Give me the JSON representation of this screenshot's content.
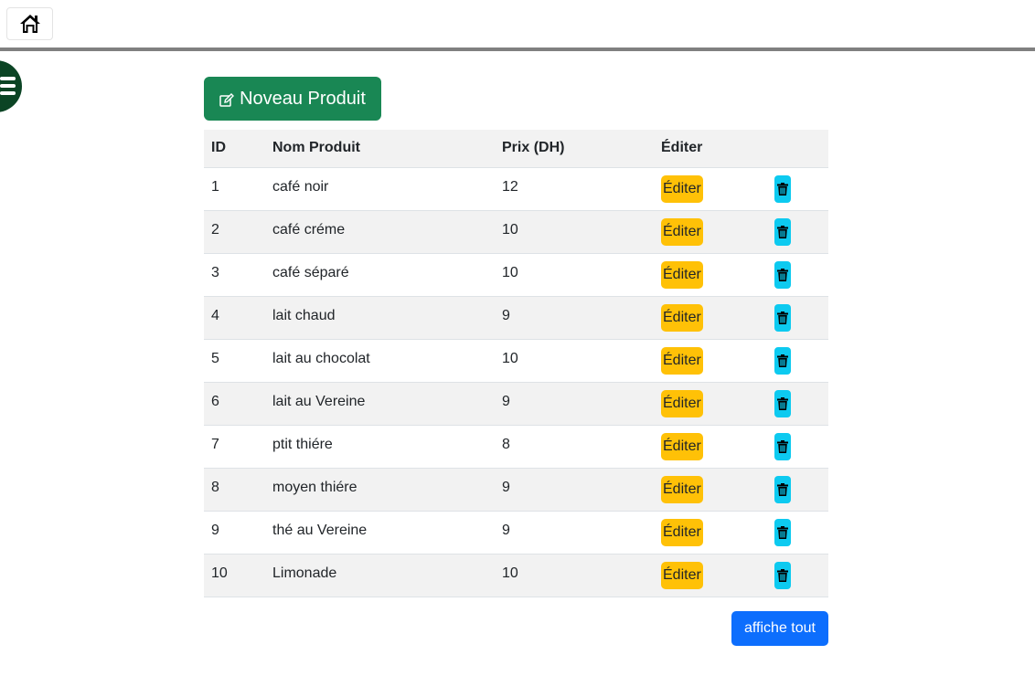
{
  "nav": {
    "home_icon": "home-icon",
    "menu_icon": "hamburger-icon"
  },
  "toolbar": {
    "new_product_label": "Noveau Produit",
    "new_product_icon": "edit-square-icon"
  },
  "table": {
    "headers": {
      "id": "ID",
      "name": "Nom Produit",
      "price": "Prix (DH)",
      "edit": "Éditer"
    },
    "edit_label": "Éditer",
    "delete_icon": "trash-icon",
    "rows": [
      {
        "id": "1",
        "name": "café noir",
        "price": "12"
      },
      {
        "id": "2",
        "name": "café créme",
        "price": "10"
      },
      {
        "id": "3",
        "name": "café séparé",
        "price": "10"
      },
      {
        "id": "4",
        "name": "lait chaud",
        "price": "9"
      },
      {
        "id": "5",
        "name": "lait au chocolat",
        "price": "10"
      },
      {
        "id": "6",
        "name": "lait au Vereine",
        "price": "9"
      },
      {
        "id": "7",
        "name": "ptit thiére",
        "price": "8"
      },
      {
        "id": "8",
        "name": "moyen thiére",
        "price": "9"
      },
      {
        "id": "9",
        "name": "thé au Vereine",
        "price": "9"
      },
      {
        "id": "10",
        "name": "Limonade",
        "price": "10"
      }
    ]
  },
  "footer": {
    "show_all_label": "affiche tout"
  },
  "colors": {
    "success": "#198754",
    "warning": "#ffc107",
    "info": "#0dcaf0",
    "primary": "#0d6efd",
    "menu": "#0b4424"
  }
}
